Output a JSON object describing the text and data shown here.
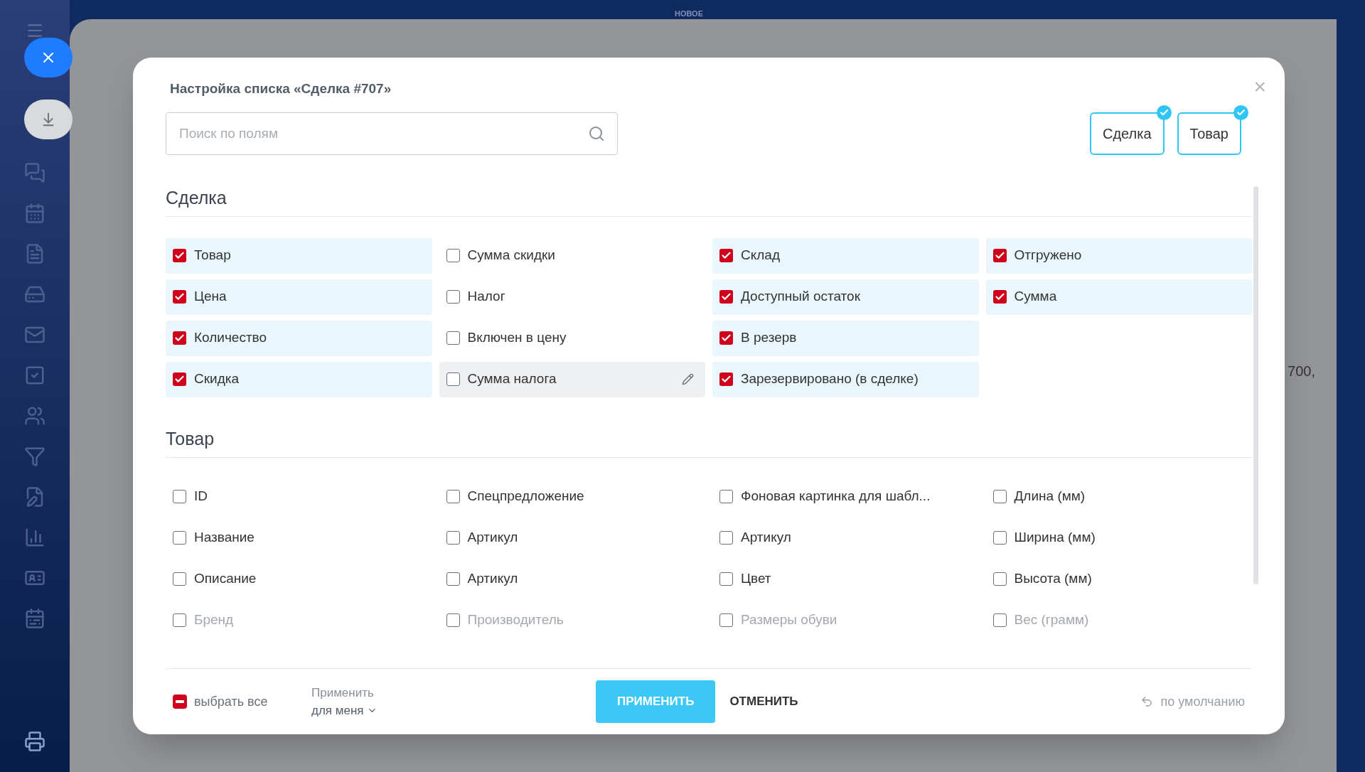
{
  "background": {
    "badge": "НОВОЕ",
    "cell_fragment": "700,"
  },
  "dialog": {
    "title": "Настройка списка «Сделка #707»",
    "close": "×"
  },
  "search": {
    "placeholder": "Поиск по полям"
  },
  "filters": [
    {
      "label": "Сделка",
      "selected": true
    },
    {
      "label": "Товар",
      "selected": true
    }
  ],
  "sections": [
    {
      "title": "Сделка",
      "columns": [
        [
          {
            "label": "Товар",
            "checked": true,
            "hovered": false
          },
          {
            "label": "Цена",
            "checked": true,
            "hovered": false
          },
          {
            "label": "Количество",
            "checked": true,
            "hovered": false
          },
          {
            "label": "Скидка",
            "checked": true,
            "hovered": false
          }
        ],
        [
          {
            "label": "Сумма скидки",
            "checked": false,
            "hovered": false
          },
          {
            "label": "Налог",
            "checked": false,
            "hovered": false
          },
          {
            "label": "Включен в цену",
            "checked": false,
            "hovered": false
          },
          {
            "label": "Сумма налога",
            "checked": false,
            "hovered": true
          }
        ],
        [
          {
            "label": "Склад",
            "checked": true,
            "hovered": false
          },
          {
            "label": "Доступный остаток",
            "checked": true,
            "hovered": false
          },
          {
            "label": "В резерв",
            "checked": true,
            "hovered": false
          },
          {
            "label": "Зарезервировано (в сделке)",
            "checked": true,
            "hovered": false
          }
        ],
        [
          {
            "label": "Отгружено",
            "checked": true,
            "hovered": false
          },
          {
            "label": "Сумма",
            "checked": true,
            "hovered": false
          }
        ]
      ]
    },
    {
      "title": "Товар",
      "columns": [
        [
          {
            "label": "ID",
            "checked": false,
            "hovered": false
          },
          {
            "label": "Название",
            "checked": false,
            "hovered": false
          },
          {
            "label": "Описание",
            "checked": false,
            "hovered": false
          },
          {
            "label": "Бренд",
            "checked": false,
            "hovered": false
          }
        ],
        [
          {
            "label": "Спецпредложение",
            "checked": false,
            "hovered": false
          },
          {
            "label": "Артикул",
            "checked": false,
            "hovered": false
          },
          {
            "label": "Артикул",
            "checked": false,
            "hovered": false
          },
          {
            "label": "Производитель",
            "checked": false,
            "hovered": false
          }
        ],
        [
          {
            "label": "Фоновая картинка для шабл...",
            "checked": false,
            "hovered": false
          },
          {
            "label": "Артикул",
            "checked": false,
            "hovered": false
          },
          {
            "label": "Цвет",
            "checked": false,
            "hovered": false
          },
          {
            "label": "Размеры обуви",
            "checked": false,
            "hovered": false
          }
        ],
        [
          {
            "label": "Длина (мм)",
            "checked": false,
            "hovered": false
          },
          {
            "label": "Ширина (мм)",
            "checked": false,
            "hovered": false
          },
          {
            "label": "Высота (мм)",
            "checked": false,
            "hovered": false
          },
          {
            "label": "Вес (грамм)",
            "checked": false,
            "hovered": false
          }
        ]
      ]
    }
  ],
  "footer": {
    "select_all": {
      "label": "выбрать все",
      "indeterminate": true
    },
    "apply_scope": {
      "label": "Применить",
      "value": "для меня"
    },
    "apply": "ПРИМЕНИТЬ",
    "cancel": "ОТМЕНИТЬ",
    "reset": "по умолчанию"
  }
}
